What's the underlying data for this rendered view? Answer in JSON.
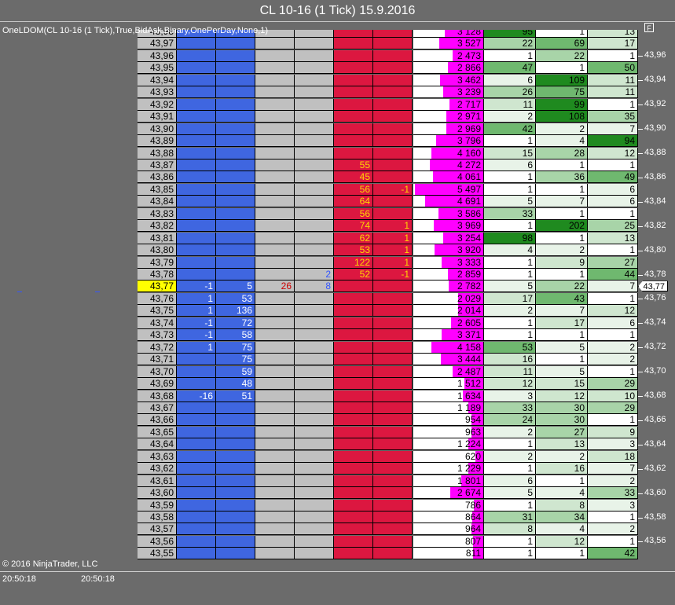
{
  "window": {
    "title": "CL 10-16 (1 Tick)  15.9.2016"
  },
  "indicator_label": "OneLDOM(CL 10-16 (1 Tick),True,BidAsk,Binary,OnePerDay,None,1)",
  "format_button": "F",
  "copyright": "© 2016 NinjaTrader, LLC",
  "time_labels": [
    "20:50:18",
    "20:50:18"
  ],
  "current_price": "43,77",
  "colors": {
    "bid": "#3f66e0",
    "ask": "#dc1740",
    "volume": "#ff00ff",
    "current": "#ffff00",
    "grey": "#c0c0c0"
  },
  "rows": [
    {
      "price": "43,98",
      "bidx": "",
      "bid": "",
      "g1": "",
      "g2": "",
      "ask": "",
      "askx": "",
      "vol": "3 128",
      "d1": "95",
      "d2": "1",
      "d3": "13"
    },
    {
      "price": "43,97",
      "bidx": "",
      "bid": "",
      "g1": "",
      "g2": "",
      "ask": "",
      "askx": "",
      "vol": "3 527",
      "d1": "22",
      "d2": "69",
      "d3": "17"
    },
    {
      "price": "43,96",
      "bidx": "",
      "bid": "",
      "g1": "",
      "g2": "",
      "ask": "",
      "askx": "",
      "vol": "2 473",
      "d1": "1",
      "d2": "22",
      "d3": "1"
    },
    {
      "price": "43,95",
      "bidx": "",
      "bid": "",
      "g1": "",
      "g2": "",
      "ask": "",
      "askx": "",
      "vol": "2 866",
      "d1": "47",
      "d2": "1",
      "d3": "50"
    },
    {
      "price": "43,94",
      "bidx": "",
      "bid": "",
      "g1": "",
      "g2": "",
      "ask": "",
      "askx": "",
      "vol": "3 462",
      "d1": "6",
      "d2": "109",
      "d3": "11"
    },
    {
      "price": "43,93",
      "bidx": "",
      "bid": "",
      "g1": "",
      "g2": "",
      "ask": "",
      "askx": "",
      "vol": "3 239",
      "d1": "26",
      "d2": "75",
      "d3": "11"
    },
    {
      "price": "43,92",
      "bidx": "",
      "bid": "",
      "g1": "",
      "g2": "",
      "ask": "",
      "askx": "",
      "vol": "2 717",
      "d1": "11",
      "d2": "99",
      "d3": "1"
    },
    {
      "price": "43,91",
      "bidx": "",
      "bid": "",
      "g1": "",
      "g2": "",
      "ask": "",
      "askx": "",
      "vol": "2 971",
      "d1": "2",
      "d2": "108",
      "d3": "35"
    },
    {
      "price": "43,90",
      "bidx": "",
      "bid": "",
      "g1": "",
      "g2": "",
      "ask": "",
      "askx": "",
      "vol": "2 969",
      "d1": "42",
      "d2": "2",
      "d3": "7"
    },
    {
      "price": "43,89",
      "bidx": "",
      "bid": "",
      "g1": "",
      "g2": "",
      "ask": "",
      "askx": "",
      "vol": "3 796",
      "d1": "1",
      "d2": "4",
      "d3": "94"
    },
    {
      "price": "43,88",
      "bidx": "",
      "bid": "",
      "g1": "",
      "g2": "",
      "ask": "",
      "askx": "",
      "vol": "4 160",
      "d1": "15",
      "d2": "28",
      "d3": "12"
    },
    {
      "price": "43,87",
      "bidx": "",
      "bid": "",
      "g1": "",
      "g2": "",
      "ask": "55",
      "askx": "",
      "vol": "4 272",
      "d1": "6",
      "d2": "1",
      "d3": "1"
    },
    {
      "price": "43,86",
      "bidx": "",
      "bid": "",
      "g1": "",
      "g2": "",
      "ask": "45",
      "askx": "",
      "vol": "4 061",
      "d1": "1",
      "d2": "36",
      "d3": "49"
    },
    {
      "price": "43,85",
      "bidx": "",
      "bid": "",
      "g1": "",
      "g2": "",
      "ask": "56",
      "askx": "-1",
      "vol": "5 497",
      "d1": "1",
      "d2": "1",
      "d3": "6"
    },
    {
      "price": "43,84",
      "bidx": "",
      "bid": "",
      "g1": "",
      "g2": "",
      "ask": "64",
      "askx": "",
      "vol": "4 691",
      "d1": "5",
      "d2": "7",
      "d3": "6"
    },
    {
      "price": "43,83",
      "bidx": "",
      "bid": "",
      "g1": "",
      "g2": "",
      "ask": "56",
      "askx": "",
      "vol": "3 586",
      "d1": "33",
      "d2": "1",
      "d3": "1"
    },
    {
      "price": "43,82",
      "bidx": "",
      "bid": "",
      "g1": "",
      "g2": "",
      "ask": "74",
      "askx": "1",
      "vol": "3 969",
      "d1": "1",
      "d2": "202",
      "d3": "25"
    },
    {
      "price": "43,81",
      "bidx": "",
      "bid": "",
      "g1": "",
      "g2": "",
      "ask": "62",
      "askx": "1",
      "vol": "3 254",
      "d1": "98",
      "d2": "1",
      "d3": "13"
    },
    {
      "price": "43,80",
      "bidx": "",
      "bid": "",
      "g1": "",
      "g2": "",
      "ask": "53",
      "askx": "1",
      "vol": "3 920",
      "d1": "4",
      "d2": "2",
      "d3": "1"
    },
    {
      "price": "43,79",
      "bidx": "",
      "bid": "",
      "g1": "",
      "g2": "",
      "ask": "122",
      "askx": "1",
      "vol": "3 333",
      "d1": "1",
      "d2": "9",
      "d3": "27"
    },
    {
      "price": "43,78",
      "bidx": "",
      "bid": "",
      "g1": "",
      "g2": "2",
      "ask": "52",
      "askx": "-1",
      "vol": "2 859",
      "d1": "1",
      "d2": "1",
      "d3": "44"
    },
    {
      "price": "43,77",
      "bidx": "-1",
      "bid": "5",
      "g1": "26",
      "g2": "8",
      "ask": "",
      "askx": "",
      "vol": "2 782",
      "d1": "5",
      "d2": "22",
      "d3": "7"
    },
    {
      "price": "43,76",
      "bidx": "1",
      "bid": "53",
      "g1": "",
      "g2": "",
      "ask": "",
      "askx": "",
      "vol": "2 029",
      "d1": "17",
      "d2": "43",
      "d3": "1"
    },
    {
      "price": "43,75",
      "bidx": "1",
      "bid": "136",
      "g1": "",
      "g2": "",
      "ask": "",
      "askx": "",
      "vol": "2 014",
      "d1": "2",
      "d2": "7",
      "d3": "12"
    },
    {
      "price": "43,74",
      "bidx": "-1",
      "bid": "72",
      "g1": "",
      "g2": "",
      "ask": "",
      "askx": "",
      "vol": "2 605",
      "d1": "1",
      "d2": "17",
      "d3": "6"
    },
    {
      "price": "43,73",
      "bidx": "-1",
      "bid": "58",
      "g1": "",
      "g2": "",
      "ask": "",
      "askx": "",
      "vol": "3 371",
      "d1": "1",
      "d2": "1",
      "d3": "1"
    },
    {
      "price": "43,72",
      "bidx": "1",
      "bid": "75",
      "g1": "",
      "g2": "",
      "ask": "",
      "askx": "",
      "vol": "4 158",
      "d1": "53",
      "d2": "5",
      "d3": "2"
    },
    {
      "price": "43,71",
      "bidx": "",
      "bid": "75",
      "g1": "",
      "g2": "",
      "ask": "",
      "askx": "",
      "vol": "3 444",
      "d1": "16",
      "d2": "1",
      "d3": "2"
    },
    {
      "price": "43,70",
      "bidx": "",
      "bid": "59",
      "g1": "",
      "g2": "",
      "ask": "",
      "askx": "",
      "vol": "2 487",
      "d1": "11",
      "d2": "5",
      "d3": "1"
    },
    {
      "price": "43,69",
      "bidx": "",
      "bid": "48",
      "g1": "",
      "g2": "",
      "ask": "",
      "askx": "",
      "vol": "1 512",
      "d1": "12",
      "d2": "15",
      "d3": "29"
    },
    {
      "price": "43,68",
      "bidx": "-16",
      "bid": "51",
      "g1": "",
      "g2": "",
      "ask": "",
      "askx": "",
      "vol": "1 634",
      "d1": "3",
      "d2": "12",
      "d3": "10"
    },
    {
      "price": "43,67",
      "bidx": "",
      "bid": "",
      "g1": "",
      "g2": "",
      "ask": "",
      "askx": "",
      "vol": "1 189",
      "d1": "33",
      "d2": "30",
      "d3": "29"
    },
    {
      "price": "43,66",
      "bidx": "",
      "bid": "",
      "g1": "",
      "g2": "",
      "ask": "",
      "askx": "",
      "vol": "954",
      "d1": "24",
      "d2": "30",
      "d3": "1"
    },
    {
      "price": "43,65",
      "bidx": "",
      "bid": "",
      "g1": "",
      "g2": "",
      "ask": "",
      "askx": "",
      "vol": "963",
      "d1": "2",
      "d2": "27",
      "d3": "9"
    },
    {
      "price": "43,64",
      "bidx": "",
      "bid": "",
      "g1": "",
      "g2": "",
      "ask": "",
      "askx": "",
      "vol": "1 224",
      "d1": "1",
      "d2": "13",
      "d3": "3"
    },
    {
      "price": "43,63",
      "bidx": "",
      "bid": "",
      "g1": "",
      "g2": "",
      "ask": "",
      "askx": "",
      "vol": "620",
      "d1": "2",
      "d2": "2",
      "d3": "18"
    },
    {
      "price": "43,62",
      "bidx": "",
      "bid": "",
      "g1": "",
      "g2": "",
      "ask": "",
      "askx": "",
      "vol": "1 229",
      "d1": "1",
      "d2": "16",
      "d3": "7"
    },
    {
      "price": "43,61",
      "bidx": "",
      "bid": "",
      "g1": "",
      "g2": "",
      "ask": "",
      "askx": "",
      "vol": "1 801",
      "d1": "6",
      "d2": "1",
      "d3": "2"
    },
    {
      "price": "43,60",
      "bidx": "",
      "bid": "",
      "g1": "",
      "g2": "",
      "ask": "",
      "askx": "",
      "vol": "2 674",
      "d1": "5",
      "d2": "4",
      "d3": "33"
    },
    {
      "price": "43,59",
      "bidx": "",
      "bid": "",
      "g1": "",
      "g2": "",
      "ask": "",
      "askx": "",
      "vol": "786",
      "d1": "1",
      "d2": "8",
      "d3": "3"
    },
    {
      "price": "43,58",
      "bidx": "",
      "bid": "",
      "g1": "",
      "g2": "",
      "ask": "",
      "askx": "",
      "vol": "864",
      "d1": "31",
      "d2": "34",
      "d3": "1"
    },
    {
      "price": "43,57",
      "bidx": "",
      "bid": "",
      "g1": "",
      "g2": "",
      "ask": "",
      "askx": "",
      "vol": "964",
      "d1": "8",
      "d2": "4",
      "d3": "2"
    },
    {
      "price": "43,56",
      "bidx": "",
      "bid": "",
      "g1": "",
      "g2": "",
      "ask": "",
      "askx": "",
      "vol": "807",
      "d1": "1",
      "d2": "12",
      "d3": "1"
    },
    {
      "price": "43,55",
      "bidx": "",
      "bid": "",
      "g1": "",
      "g2": "",
      "ask": "",
      "askx": "",
      "vol": "811",
      "d1": "1",
      "d2": "1",
      "d3": "42"
    }
  ],
  "axis_labels": [
    "43,96",
    "43,94",
    "43,92",
    "43,90",
    "43,88",
    "43,86",
    "43,84",
    "43,82",
    "43,80",
    "43,78",
    "43,76",
    "43,74",
    "43,72",
    "43,70",
    "43,68",
    "43,66",
    "43,64",
    "43,62",
    "43,60",
    "43,58",
    "43,56"
  ]
}
